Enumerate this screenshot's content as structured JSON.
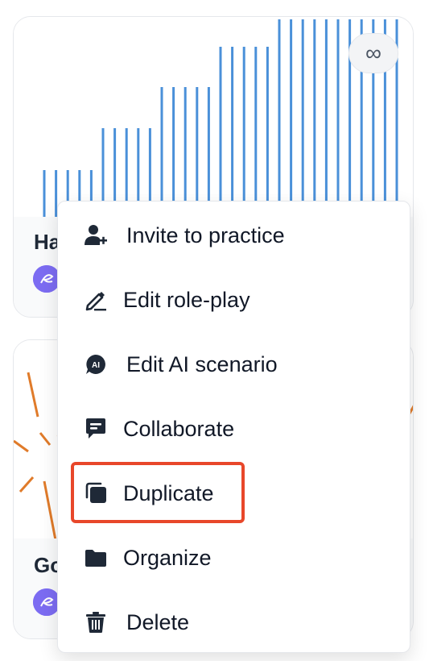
{
  "cards": [
    {
      "title": "Ha",
      "action_icon": "infinity-icon"
    },
    {
      "title": "Go"
    }
  ],
  "menu": {
    "items": [
      {
        "label": "Invite to practice",
        "icon": "user-plus-icon"
      },
      {
        "label": "Edit role-play",
        "icon": "pencil-icon"
      },
      {
        "label": "Edit AI scenario",
        "icon": "ai-chat-icon",
        "icon_text": "AI"
      },
      {
        "label": "Collaborate",
        "icon": "message-icon"
      },
      {
        "label": "Duplicate",
        "icon": "duplicate-icon",
        "highlighted": true
      },
      {
        "label": "Organize",
        "icon": "folder-icon"
      },
      {
        "label": "Delete",
        "icon": "trash-icon"
      }
    ]
  },
  "colors": {
    "bars": "#4a90d9",
    "rays": "#e07b2a",
    "highlight": "#e8472a",
    "avatar": "#7c6cf2"
  }
}
